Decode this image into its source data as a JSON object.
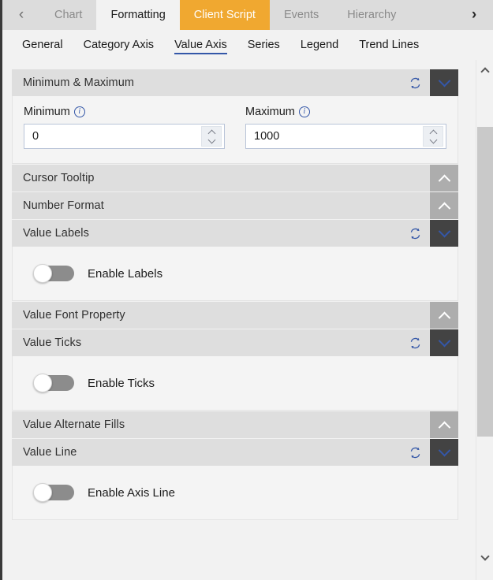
{
  "colors": {
    "accent_highlight": "#f0a830",
    "accent_blue": "#3457a8",
    "header_gray": "#dedede",
    "chevron_open_bg": "#434343",
    "chevron_closed_bg": "#adadad",
    "toggle_off_track": "#8c8c8c"
  },
  "tabstrip": {
    "prev_label": "‹",
    "next_label": "›",
    "prev_icon": "chevron-left-icon",
    "next_icon": "chevron-right-icon",
    "tabs": [
      {
        "label": "Chart",
        "state": "inactive"
      },
      {
        "label": "Formatting",
        "state": "active"
      },
      {
        "label": "Client Script",
        "state": "highlight"
      },
      {
        "label": "Events",
        "state": "inactive"
      },
      {
        "label": "Hierarchy",
        "state": "inactive"
      }
    ]
  },
  "subtabs": {
    "items": [
      {
        "label": "General",
        "active": false
      },
      {
        "label": "Category Axis",
        "active": false
      },
      {
        "label": "Value Axis",
        "active": true
      },
      {
        "label": "Series",
        "active": false
      },
      {
        "label": "Legend",
        "active": false
      },
      {
        "label": "Trend Lines",
        "active": false
      }
    ]
  },
  "sections": [
    {
      "title": "Minimum & Maximum",
      "expanded": true,
      "has_refresh": true,
      "refresh_icon": "refresh-icon",
      "chevron_icon": "chevron-down-icon",
      "body": "minmax"
    },
    {
      "title": "Cursor Tooltip",
      "expanded": false,
      "has_refresh": false,
      "chevron_icon": "chevron-up-icon",
      "body": "none"
    },
    {
      "title": "Number Format",
      "expanded": false,
      "has_refresh": false,
      "chevron_icon": "chevron-up-icon",
      "body": "none"
    },
    {
      "title": "Value Labels",
      "expanded": true,
      "has_refresh": true,
      "refresh_icon": "refresh-icon",
      "chevron_icon": "chevron-down-icon",
      "body": "toggle",
      "toggle_label": "Enable Labels",
      "toggle_on": false
    },
    {
      "title": "Value Font Property",
      "expanded": false,
      "has_refresh": false,
      "chevron_icon": "chevron-up-icon",
      "body": "none"
    },
    {
      "title": "Value Ticks",
      "expanded": true,
      "has_refresh": true,
      "refresh_icon": "refresh-icon",
      "chevron_icon": "chevron-down-icon",
      "body": "toggle",
      "toggle_label": "Enable Ticks",
      "toggle_on": false
    },
    {
      "title": "Value Alternate Fills",
      "expanded": false,
      "has_refresh": false,
      "chevron_icon": "chevron-up-icon",
      "body": "none"
    },
    {
      "title": "Value Line",
      "expanded": true,
      "has_refresh": true,
      "refresh_icon": "refresh-icon",
      "chevron_icon": "chevron-down-icon",
      "body": "toggle",
      "toggle_label": "Enable Axis Line",
      "toggle_on": false
    }
  ],
  "minmax": {
    "minimum": {
      "label": "Minimum",
      "info_icon": "info-icon",
      "value": "0",
      "placeholder": ""
    },
    "maximum": {
      "label": "Maximum",
      "info_icon": "info-icon",
      "value": "1000",
      "placeholder": ""
    }
  },
  "scrollbar": {
    "up_icon": "scroll-up-arrow-icon",
    "down_icon": "scroll-down-arrow-icon",
    "thumb_name": "scrollbar-thumb"
  }
}
